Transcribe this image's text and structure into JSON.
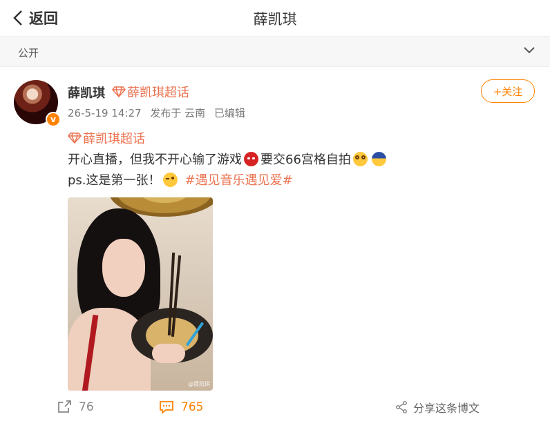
{
  "header": {
    "back_label": "返回",
    "title": "薛凯琪"
  },
  "visibility": {
    "label": "公开"
  },
  "post": {
    "author": "薛凯琪",
    "super_topic": "薛凯琪超话",
    "meta": {
      "date": "26-5-19 14:27",
      "source": "发布于 云南",
      "edited": "已编辑"
    },
    "follow_label": "+关注",
    "topic_tag": "薛凯琪超话",
    "text_line1_a": "开心直播，但我不开心输了游戏",
    "text_line1_b": "要交66宫格自拍",
    "text_line2_a": "ps.这是第一张！",
    "hashtag": "#遇见音乐遇见爱#",
    "image_watermark": "@薛凯琪"
  },
  "actions": {
    "repost_count": "76",
    "comment_count": "765",
    "share_label": "分享这条博文"
  },
  "colors": {
    "accent_orange": "#ff8200",
    "link_orange": "#eb7350"
  },
  "icons": [
    "back-chevron-icon",
    "chevron-down-icon",
    "verified-badge-icon",
    "diamond-icon",
    "repost-icon",
    "comment-icon",
    "share-icon"
  ]
}
